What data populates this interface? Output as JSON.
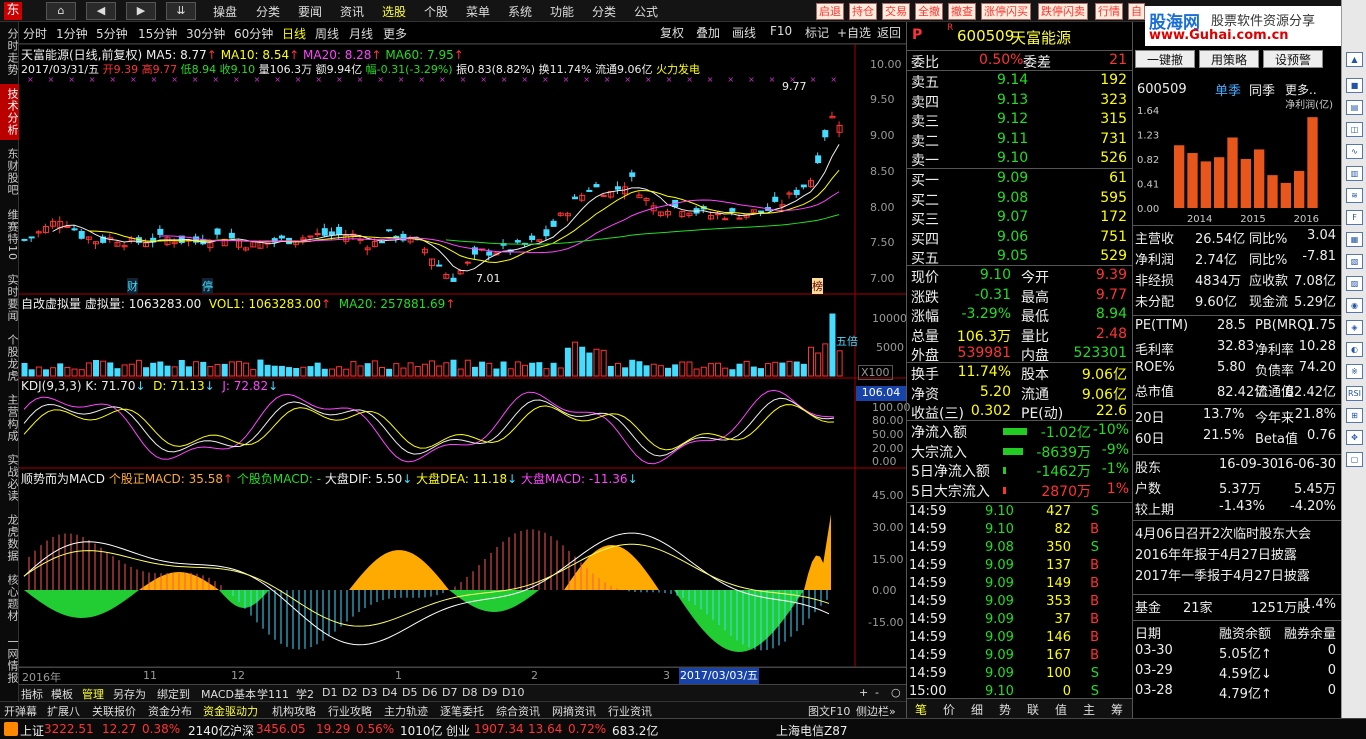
{
  "menu": {
    "items": [
      "操盘",
      "分类",
      "要闻",
      "资讯",
      "选股",
      "个股",
      "菜单",
      "系统",
      "功能",
      "分类",
      "公式"
    ],
    "active": "选股",
    "quick": [
      "启退",
      "持仓",
      "交易",
      "全撤",
      "撤查",
      "涨停闪买",
      "跌停闪卖",
      "行情",
      "自"
    ]
  },
  "brand": {
    "name": "股海网",
    "sub": "股票软件资源分享",
    "url": "www.Guhai.com.cn"
  },
  "lefttabs": [
    "分时走势",
    "技术分析",
    "东财股吧",
    "维赛特10",
    "实时要闻",
    "个股龙虎",
    "主营构成",
    "实战必读",
    "龙虎数据",
    "核心题材",
    "一网情报"
  ],
  "periods": [
    "分时",
    "1分钟",
    "5分钟",
    "15分钟",
    "30分钟",
    "60分钟",
    "日线",
    "周线",
    "月线",
    "更多"
  ],
  "periods_active": "日线",
  "toolbtns": [
    "复权",
    "叠加",
    "画线",
    "F10",
    "标记",
    "+自选",
    "返回"
  ],
  "kline": {
    "title": "天富能源(日线,前复权)",
    "ma5": "MA5: 8.77",
    "ma10": "MA10: 8.54",
    "ma20": "MA20: 8.28",
    "ma60": "MA60: 7.95",
    "info": {
      "date": "2017/03/31/五",
      "open": "开9.39",
      "high": "高9.77",
      "low": "低8.94",
      "close": "收9.10",
      "vol": "量106.3万",
      "amt": "额9.94亿",
      "chg": "幅-0.31(-3.29%)",
      "amp": "振0.83(8.82%)",
      "turn": "换11.74%",
      "float": "流通9.06亿",
      "sector": "火力发电"
    },
    "axis": [
      "10.00",
      "9.50",
      "9.00",
      "8.50",
      "8.00",
      "7.50",
      "7.00"
    ],
    "peak": "9.77",
    "trough": "7.01",
    "marks": [
      "财",
      "停",
      "榜"
    ]
  },
  "volume": {
    "label": "自改虚拟量",
    "virt": "虚拟量: 1063283.00",
    "vol1": "VOL1: 1063283.00",
    "ma20": "MA20: 257881.69",
    "axis": [
      "10000",
      "5000",
      "X100"
    ],
    "note": "五倍"
  },
  "kdj": {
    "label": "KDJ(9,3,3)",
    "k": "K: 71.70",
    "d": "D: 71.13",
    "j": "J: 72.82",
    "axis": [
      "106.04",
      "100.00",
      "80.00",
      "50.00",
      "20.00",
      "0.00"
    ]
  },
  "macd": {
    "label": "顺势而为MACD",
    "pos": "个股正MACD: 35.58",
    "neg": "个股负MACD: -",
    "dif": "大盘DIF: 5.50",
    "dea": "大盘DEA: 11.18",
    "big": "大盘MACD: -11.36",
    "axis": [
      "45.00",
      "30.00",
      "15.00",
      "0.00",
      "-15.00"
    ]
  },
  "xaxis": {
    "labels": [
      "2016年",
      "11",
      "12",
      "1",
      "2",
      "3"
    ],
    "cursor": "2017/03/03/五"
  },
  "btmtabs": [
    "指标",
    "模板",
    "管理",
    "另存为",
    "绑定到",
    "MACD基本",
    "学111",
    "学2",
    "D1",
    "D2",
    "D3",
    "D4",
    "D5",
    "D6",
    "D7",
    "D8",
    "D9",
    "D10"
  ],
  "btm2": [
    "开弹幕",
    "扩展八",
    "关联报价",
    "资金分布",
    "资金驱动力",
    "机构攻略",
    "行业攻略",
    "主力轨迹",
    "逐笔委托",
    "综合资讯",
    "网摘资讯",
    "行业资讯"
  ],
  "btm2_right": [
    "图文F10",
    "侧边栏»"
  ],
  "stock": {
    "code": "600509",
    "name": "天富能源",
    "ratio_l": "委比",
    "ratio": "0.50%",
    "diff_l": "委差",
    "diff": "21"
  },
  "asks": [
    {
      "l": "卖五",
      "p": "9.14",
      "v": "192"
    },
    {
      "l": "卖四",
      "p": "9.13",
      "v": "323"
    },
    {
      "l": "卖三",
      "p": "9.12",
      "v": "315"
    },
    {
      "l": "卖二",
      "p": "9.11",
      "v": "731"
    },
    {
      "l": "卖一",
      "p": "9.10",
      "v": "526"
    }
  ],
  "bids": [
    {
      "l": "买一",
      "p": "9.09",
      "v": "61"
    },
    {
      "l": "买二",
      "p": "9.08",
      "v": "595"
    },
    {
      "l": "买三",
      "p": "9.07",
      "v": "172"
    },
    {
      "l": "买四",
      "p": "9.06",
      "v": "751"
    },
    {
      "l": "买五",
      "p": "9.05",
      "v": "529"
    }
  ],
  "quote": [
    [
      "现价",
      "9.10",
      "今开",
      "9.39"
    ],
    [
      "涨跌",
      "-0.31",
      "最高",
      "9.77"
    ],
    [
      "涨幅",
      "-3.29%",
      "最低",
      "8.94"
    ],
    [
      "总量",
      "106.3万",
      "量比",
      "2.48"
    ],
    [
      "外盘",
      "539981",
      "内盘",
      "523301"
    ]
  ],
  "quote2": [
    [
      "换手",
      "11.74%",
      "股本",
      "9.06亿"
    ],
    [
      "净资",
      "5.20",
      "流通",
      "9.06亿"
    ],
    [
      "收益(三)",
      "0.302",
      "PE(动)",
      "22.6"
    ]
  ],
  "flow": [
    [
      "净流入额",
      "-1.02亿",
      "-10%"
    ],
    [
      "大宗流入",
      "-8639万",
      "-9%"
    ],
    [
      "5日净流入额",
      "-1462万",
      "-1%"
    ],
    [
      "5日大宗流入",
      "2870万",
      "1%"
    ]
  ],
  "ticks": [
    [
      "14:59",
      "9.10",
      "427",
      "S"
    ],
    [
      "14:59",
      "9.10",
      "82",
      "B"
    ],
    [
      "14:59",
      "9.08",
      "350",
      "S"
    ],
    [
      "14:59",
      "9.09",
      "137",
      "B"
    ],
    [
      "14:59",
      "9.09",
      "149",
      "B"
    ],
    [
      "14:59",
      "9.09",
      "353",
      "B"
    ],
    [
      "14:59",
      "9.09",
      "37",
      "B"
    ],
    [
      "14:59",
      "9.09",
      "146",
      "B"
    ],
    [
      "14:59",
      "9.09",
      "167",
      "B"
    ],
    [
      "14:59",
      "9.09",
      "100",
      "S"
    ],
    [
      "15:00",
      "9.10",
      "0",
      "S"
    ]
  ],
  "rtabs": [
    "笔",
    "价",
    "细",
    "势",
    "联",
    "值",
    "主",
    "筹"
  ],
  "fin": {
    "btns": [
      "一键撤",
      "用策略",
      "设预警"
    ],
    "code": "600509",
    "tab1": "单季",
    "tab2": "同季",
    "more": "更多..",
    "chart_title": "净利润(亿)",
    "yaxis": [
      "1.64",
      "1.23",
      "0.82",
      "0.41",
      "0.00"
    ],
    "xaxis": [
      "2014",
      "2015",
      "2016"
    ],
    "rows": [
      [
        "主营收",
        "26.54亿",
        "同比%",
        "3.04"
      ],
      [
        "净利润",
        "2.74亿",
        "同比%",
        "-7.81"
      ],
      [
        "非经损",
        "4834万",
        "应收款",
        "7.08亿"
      ],
      [
        "未分配",
        "9.60亿",
        "现金流",
        "5.29亿"
      ]
    ],
    "rows2": [
      [
        "PE(TTM)",
        "28.5",
        "PB(MRQ)",
        "1.75"
      ],
      [
        "毛利率",
        "32.83",
        "净利率",
        "10.28"
      ],
      [
        "ROE%",
        "5.80",
        "负债率",
        "74.20"
      ],
      [
        "总市值",
        "82.42亿",
        "流通值",
        "82.42亿"
      ]
    ],
    "rows3": [
      [
        "20日",
        "13.7%",
        "今年来",
        "21.8%"
      ],
      [
        "60日",
        "21.5%",
        "Beta值",
        "0.76"
      ]
    ],
    "rows4": [
      [
        "股东",
        "16-09-30",
        "16-06-30"
      ],
      [
        "户数",
        "5.37万",
        "5.45万"
      ],
      [
        "较上期",
        "-1.43%",
        "-4.20%"
      ]
    ],
    "news": [
      "4月06日召开2次临时股东大会",
      "2016年年报于4月27日披露",
      "2017年一季报于4月27日披露"
    ],
    "fund": [
      "基金",
      "21家",
      "1251万股",
      "1.4%"
    ],
    "margin_h": [
      "日期",
      "融资余额",
      "融券余量"
    ],
    "margin": [
      [
        "03-30",
        "5.05亿↑",
        "0"
      ],
      [
        "03-29",
        "4.59亿↓",
        "0"
      ],
      [
        "03-28",
        "4.79亿↑",
        "0"
      ]
    ]
  },
  "chart_data": {
    "type": "bar",
    "title": "净利润(亿)",
    "categories": [
      "2014",
      "2014",
      "2014",
      "2014",
      "2015",
      "2015",
      "2015",
      "2015",
      "2016",
      "2016",
      "2016",
      "2016"
    ],
    "values": [
      1.05,
      0.92,
      0.78,
      0.85,
      1.18,
      0.82,
      0.98,
      0.55,
      0.42,
      0.62,
      1.52,
      0
    ],
    "ylim": [
      0,
      1.64
    ]
  },
  "status": {
    "sh": "上证",
    "sh_v": "3222.51",
    "sh_c": "12.27",
    "sh_p": "0.38%",
    "sh_a": "2140亿",
    "sz": "沪深",
    "sz_v": "3456.05",
    "sz_c": "19.29",
    "sz_p": "0.56%",
    "sz_a": "1010亿",
    "cy": "创业",
    "cy_v": "1907.34",
    "cy_c": "13.64",
    "cy_p": "0.72%",
    "cy_a": "683.2亿",
    "isp": "上海电信Z87"
  }
}
